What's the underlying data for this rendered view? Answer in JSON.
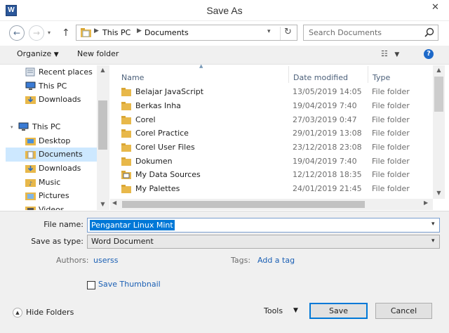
{
  "window": {
    "title": "Save As",
    "app_icon": "W",
    "close_glyph": "✕"
  },
  "nav": {
    "back_icon": "back-arrow-icon",
    "forward_icon": "forward-arrow-icon",
    "address": {
      "segments": [
        "This PC",
        "Documents"
      ]
    },
    "search": {
      "placeholder": "Search Documents"
    }
  },
  "toolbar": {
    "organize_label": "Organize",
    "new_folder_label": "New folder"
  },
  "sidebar": {
    "items": [
      {
        "label": "Recent places",
        "icon": "recent-places-icon"
      },
      {
        "label": "This PC",
        "icon": "computer-icon"
      },
      {
        "label": "Downloads",
        "icon": "downloads-icon"
      },
      {
        "label": "This PC",
        "icon": "computer-icon"
      },
      {
        "label": "Desktop",
        "icon": "desktop-icon"
      },
      {
        "label": "Documents",
        "icon": "documents-icon",
        "selected": true
      },
      {
        "label": "Downloads",
        "icon": "downloads-icon"
      },
      {
        "label": "Music",
        "icon": "music-icon"
      },
      {
        "label": "Pictures",
        "icon": "pictures-icon"
      },
      {
        "label": "Videos",
        "icon": "videos-icon"
      }
    ]
  },
  "columns": {
    "name": "Name",
    "date": "Date modified",
    "type": "Type"
  },
  "files": [
    {
      "name": "Belajar JavaScript",
      "date": "13/05/2019 14:05",
      "type": "File folder"
    },
    {
      "name": "Berkas Inha",
      "date": "19/04/2019 7:40",
      "type": "File folder"
    },
    {
      "name": "Corel",
      "date": "27/03/2019 0:47",
      "type": "File folder"
    },
    {
      "name": "Corel Practice",
      "date": "29/01/2019 13:08",
      "type": "File folder"
    },
    {
      "name": "Corel User Files",
      "date": "23/12/2018 23:08",
      "type": "File folder"
    },
    {
      "name": "Dokumen",
      "date": "19/04/2019 7:40",
      "type": "File folder"
    },
    {
      "name": "My Data Sources",
      "date": "12/12/2018 18:35",
      "type": "File folder"
    },
    {
      "name": "My Palettes",
      "date": "24/01/2019 21:45",
      "type": "File folder"
    }
  ],
  "form": {
    "filename_label": "File name:",
    "filename_value": "Pengantar Linux Mint",
    "savetype_label": "Save as type:",
    "savetype_value": "Word Document",
    "authors_label": "Authors:",
    "authors_value": "userss",
    "tags_label": "Tags:",
    "tags_value": "Add a tag",
    "thumbnail_label": "Save Thumbnail"
  },
  "footer": {
    "hide_folders_label": "Hide Folders",
    "tools_label": "Tools",
    "save_label": "Save",
    "cancel_label": "Cancel"
  },
  "colors": {
    "accent": "#0078d7",
    "link": "#1a5fb4",
    "selection": "#cde8ff",
    "folder": "#e8b84a"
  }
}
